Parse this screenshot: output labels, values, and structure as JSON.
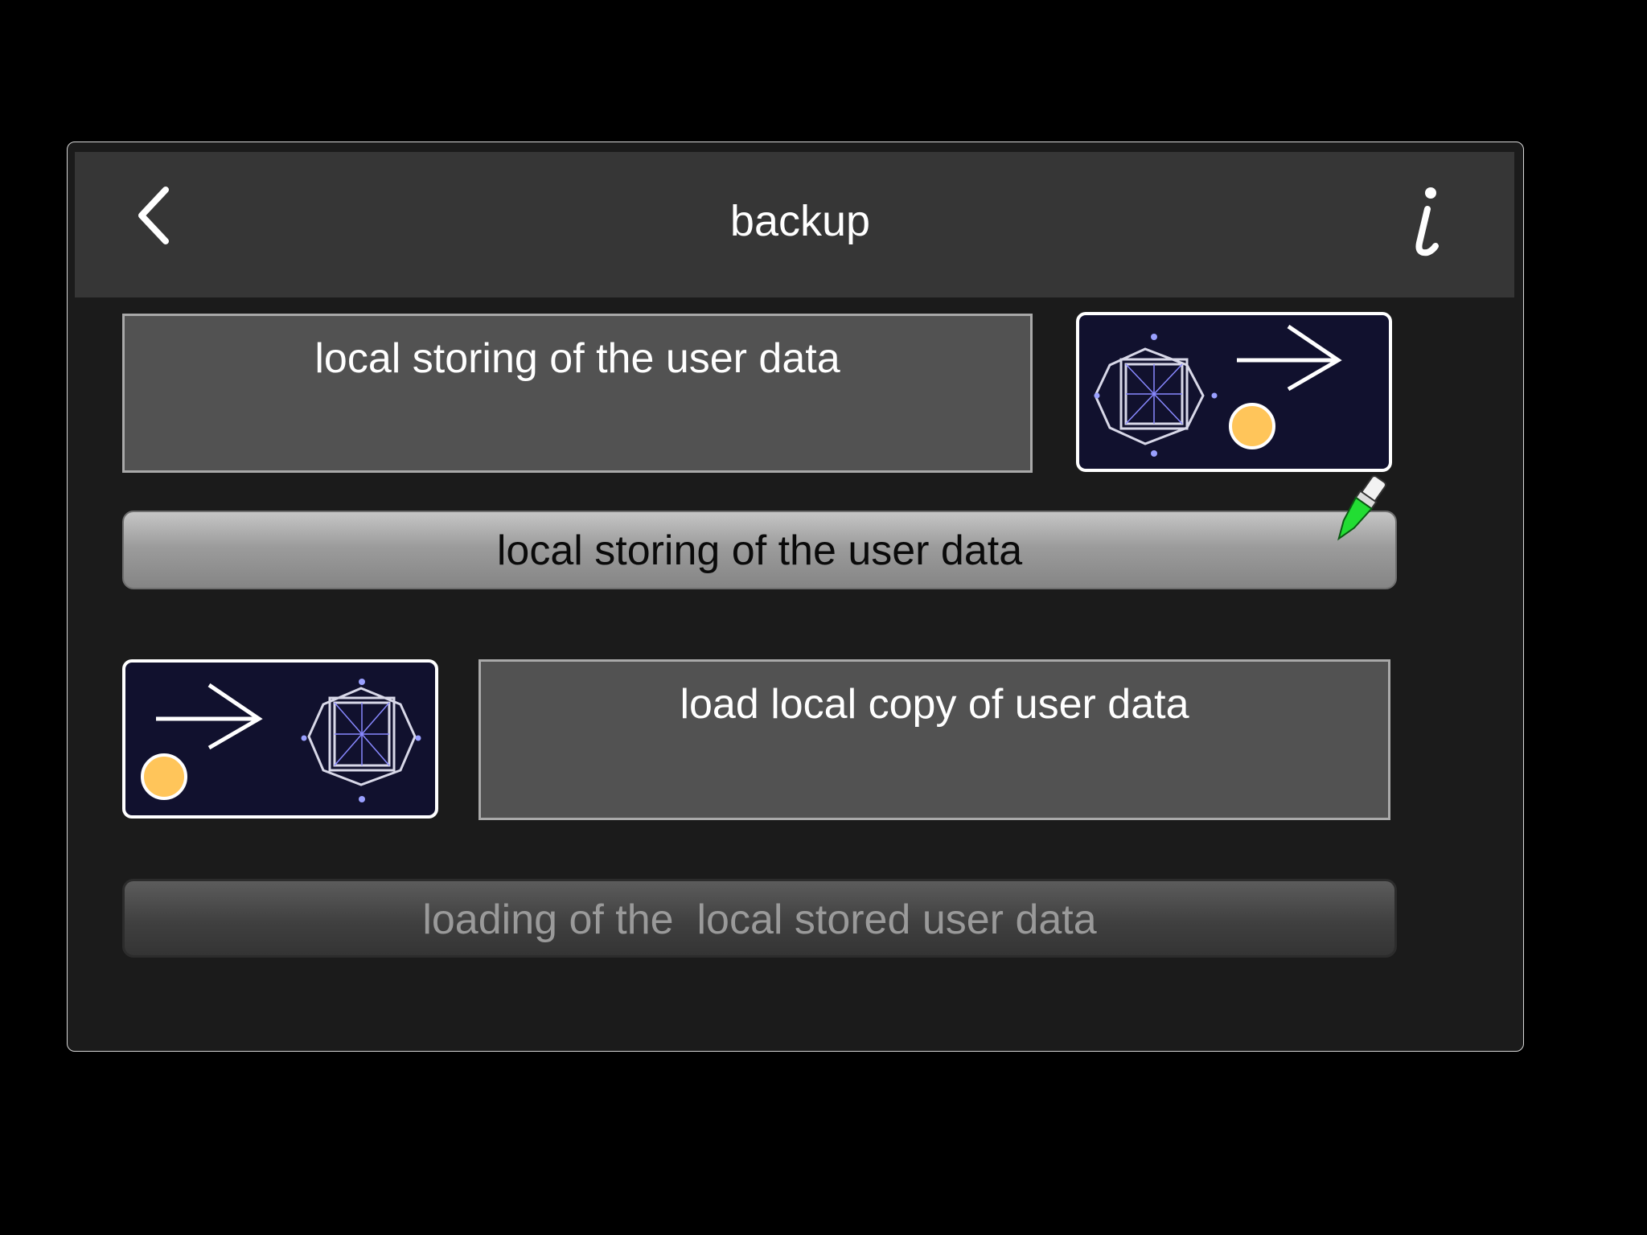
{
  "header": {
    "title": "backup",
    "back_icon": "chevron-left-icon",
    "info_icon": "info-icon"
  },
  "store_section": {
    "description": "local storing of the user data",
    "button_label": "local storing of the user data",
    "tile_icon": "save-to-local-storage-icon"
  },
  "load_section": {
    "description": "load local copy of user data",
    "button_label": "loading of the  local stored user data",
    "button_enabled": false,
    "tile_icon": "load-from-local-storage-icon"
  },
  "colors": {
    "background": "#000000",
    "panel": "#1b1b1b",
    "header": "#363636",
    "tile": "#11112e",
    "dot": "#ffc55a",
    "pen_green": "#22dd33"
  }
}
